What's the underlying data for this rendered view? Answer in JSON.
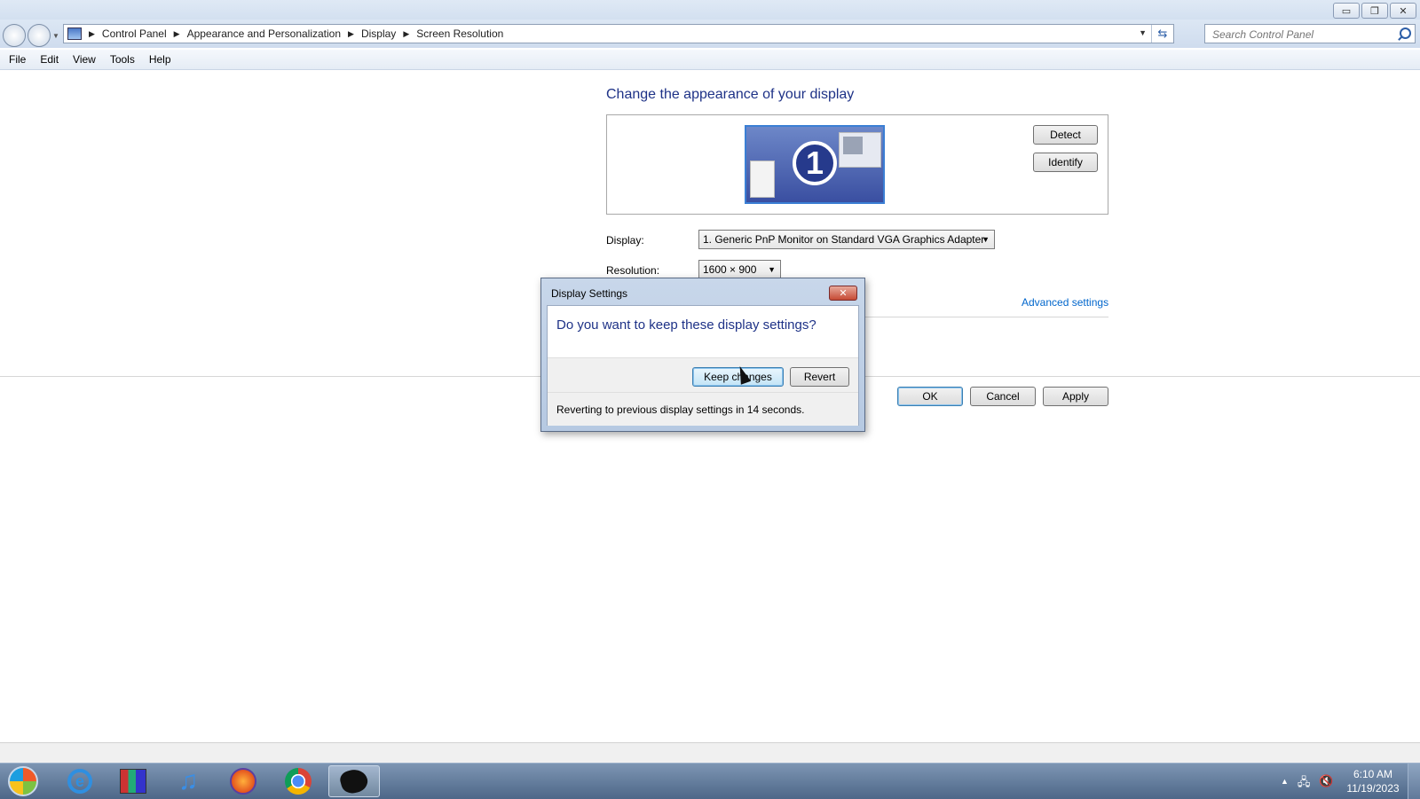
{
  "window": {
    "minimize_glyph": "▭",
    "restore_glyph": "❐",
    "close_glyph": "✕"
  },
  "address_bar": {
    "breadcrumbs": [
      "Control Panel",
      "Appearance and Personalization",
      "Display",
      "Screen Resolution"
    ],
    "search_placeholder": "Search Control Panel"
  },
  "menu": {
    "items": [
      "File",
      "Edit",
      "View",
      "Tools",
      "Help"
    ]
  },
  "main": {
    "heading": "Change the appearance of your display",
    "monitor_number": "1",
    "detect_label": "Detect",
    "identify_label": "Identify",
    "display_label": "Display:",
    "display_value": "1. Generic PnP Monitor on Standard VGA Graphics Adapter",
    "resolution_label": "Resolution:",
    "resolution_value": "1600 × 900",
    "advanced_link": "Advanced settings",
    "ok_label": "OK",
    "cancel_label": "Cancel",
    "apply_label": "Apply"
  },
  "dialog": {
    "title": "Display Settings",
    "question": "Do you want to keep these display settings?",
    "keep_label": "Keep changes",
    "revert_label": "Revert",
    "countdown_text": "Reverting to previous display settings in 14 seconds."
  },
  "taskbar": {
    "ie_glyph": "e",
    "itunes_glyph": "♫",
    "tray_arrow": "▲",
    "tray_network": "🖧",
    "tray_volume": "🔇",
    "time": "6:10 AM",
    "date": "11/19/2023"
  },
  "colors": {
    "heading_blue": "#1e3287",
    "link_blue": "#0066cc",
    "taskbar": "#4d6788"
  }
}
